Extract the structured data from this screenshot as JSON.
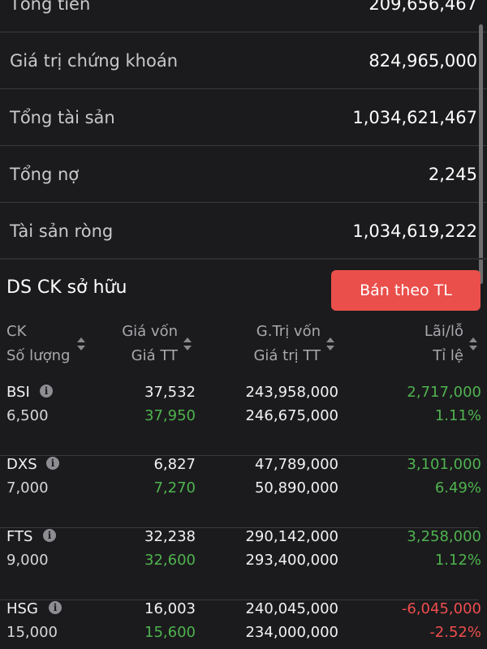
{
  "summary": [
    {
      "label": "Tổng tiền",
      "value": "209,656,467"
    },
    {
      "label": "Giá trị chứng khoán",
      "value": "824,965,000"
    },
    {
      "label": "Tổng tài sản",
      "value": "1,034,621,467"
    },
    {
      "label": "Tổng nợ",
      "value": "2,245"
    },
    {
      "label": "Tài sản ròng",
      "value": "1,034,619,222"
    }
  ],
  "holdings": {
    "title": "DS CK sở hữu",
    "sell_button": "Bán theo TL",
    "headers": {
      "col1_top": "CK",
      "col1_bottom": "Số lượng",
      "col2_top": "Giá vốn",
      "col2_bottom": "Giá TT",
      "col3_top": "G.Trị vốn",
      "col3_bottom": "Giá trị TT",
      "col4_top": "Lãi/lỗ",
      "col4_bottom": "Tỉ lệ"
    },
    "rows": [
      {
        "symbol": "BSI",
        "quantity": "6,500",
        "cost_price": "37,532",
        "market_price": "37,950",
        "cost_value": "243,958,000",
        "market_value": "246,675,000",
        "pnl": "2,717,000",
        "pnl_pct": "1.11%",
        "trend": "up"
      },
      {
        "symbol": "DXS",
        "quantity": "7,000",
        "cost_price": "6,827",
        "market_price": "7,270",
        "cost_value": "47,789,000",
        "market_value": "50,890,000",
        "pnl": "3,101,000",
        "pnl_pct": "6.49%",
        "trend": "up"
      },
      {
        "symbol": "FTS",
        "quantity": "9,000",
        "cost_price": "32,238",
        "market_price": "32,600",
        "cost_value": "290,142,000",
        "market_value": "293,400,000",
        "pnl": "3,258,000",
        "pnl_pct": "1.12%",
        "trend": "up"
      },
      {
        "symbol": "HSG",
        "quantity": "15,000",
        "cost_price": "16,003",
        "market_price": "15,600",
        "cost_value": "240,045,000",
        "market_value": "234,000,000",
        "pnl": "-6,045,000",
        "pnl_pct": "-2.52%",
        "trend": "down"
      }
    ]
  },
  "colors": {
    "positive": "#4fb34f",
    "negative": "#ef4d4d",
    "sell_button": "#ea4f4b",
    "background": "#1b1b1d"
  },
  "icons": {
    "info": "info-circle-icon",
    "sort": "sort-arrows-icon"
  }
}
